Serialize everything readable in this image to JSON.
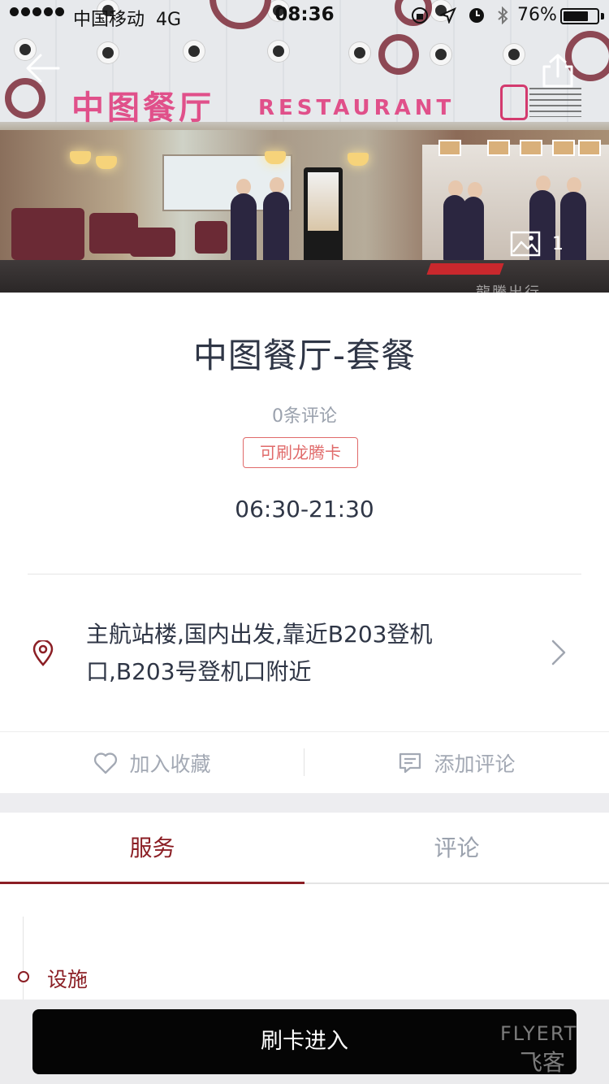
{
  "status_bar": {
    "carrier": "中国移动",
    "network": "4G",
    "time": "08:36",
    "battery_percent": "76%",
    "battery_level": 0.76
  },
  "hero": {
    "sign_cn": "中图餐厅",
    "sign_en": "RESTAURANT",
    "photo_count": "1",
    "watermark": "龍騰出行"
  },
  "info": {
    "title": "中图餐厅-套餐",
    "reviews": "0条评论",
    "badge": "可刷龙腾卡",
    "hours": "06:30-21:30",
    "address": "主航站楼,国内出发,靠近B203登机口,B203号登机口附近"
  },
  "actions": {
    "favorite": "加入收藏",
    "comment": "添加评论"
  },
  "tabs": [
    {
      "label": "服务",
      "active": true
    },
    {
      "label": "评论",
      "active": false
    }
  ],
  "section": {
    "label": "设施"
  },
  "cta": {
    "label": "刷卡进入"
  },
  "watermark": {
    "en": "FLYERT",
    "cn": "飞客"
  },
  "colors": {
    "accent": "#8b1e24",
    "badge": "#e06a6a",
    "muted": "#9aa1ad",
    "cta_bg": "#050505"
  }
}
